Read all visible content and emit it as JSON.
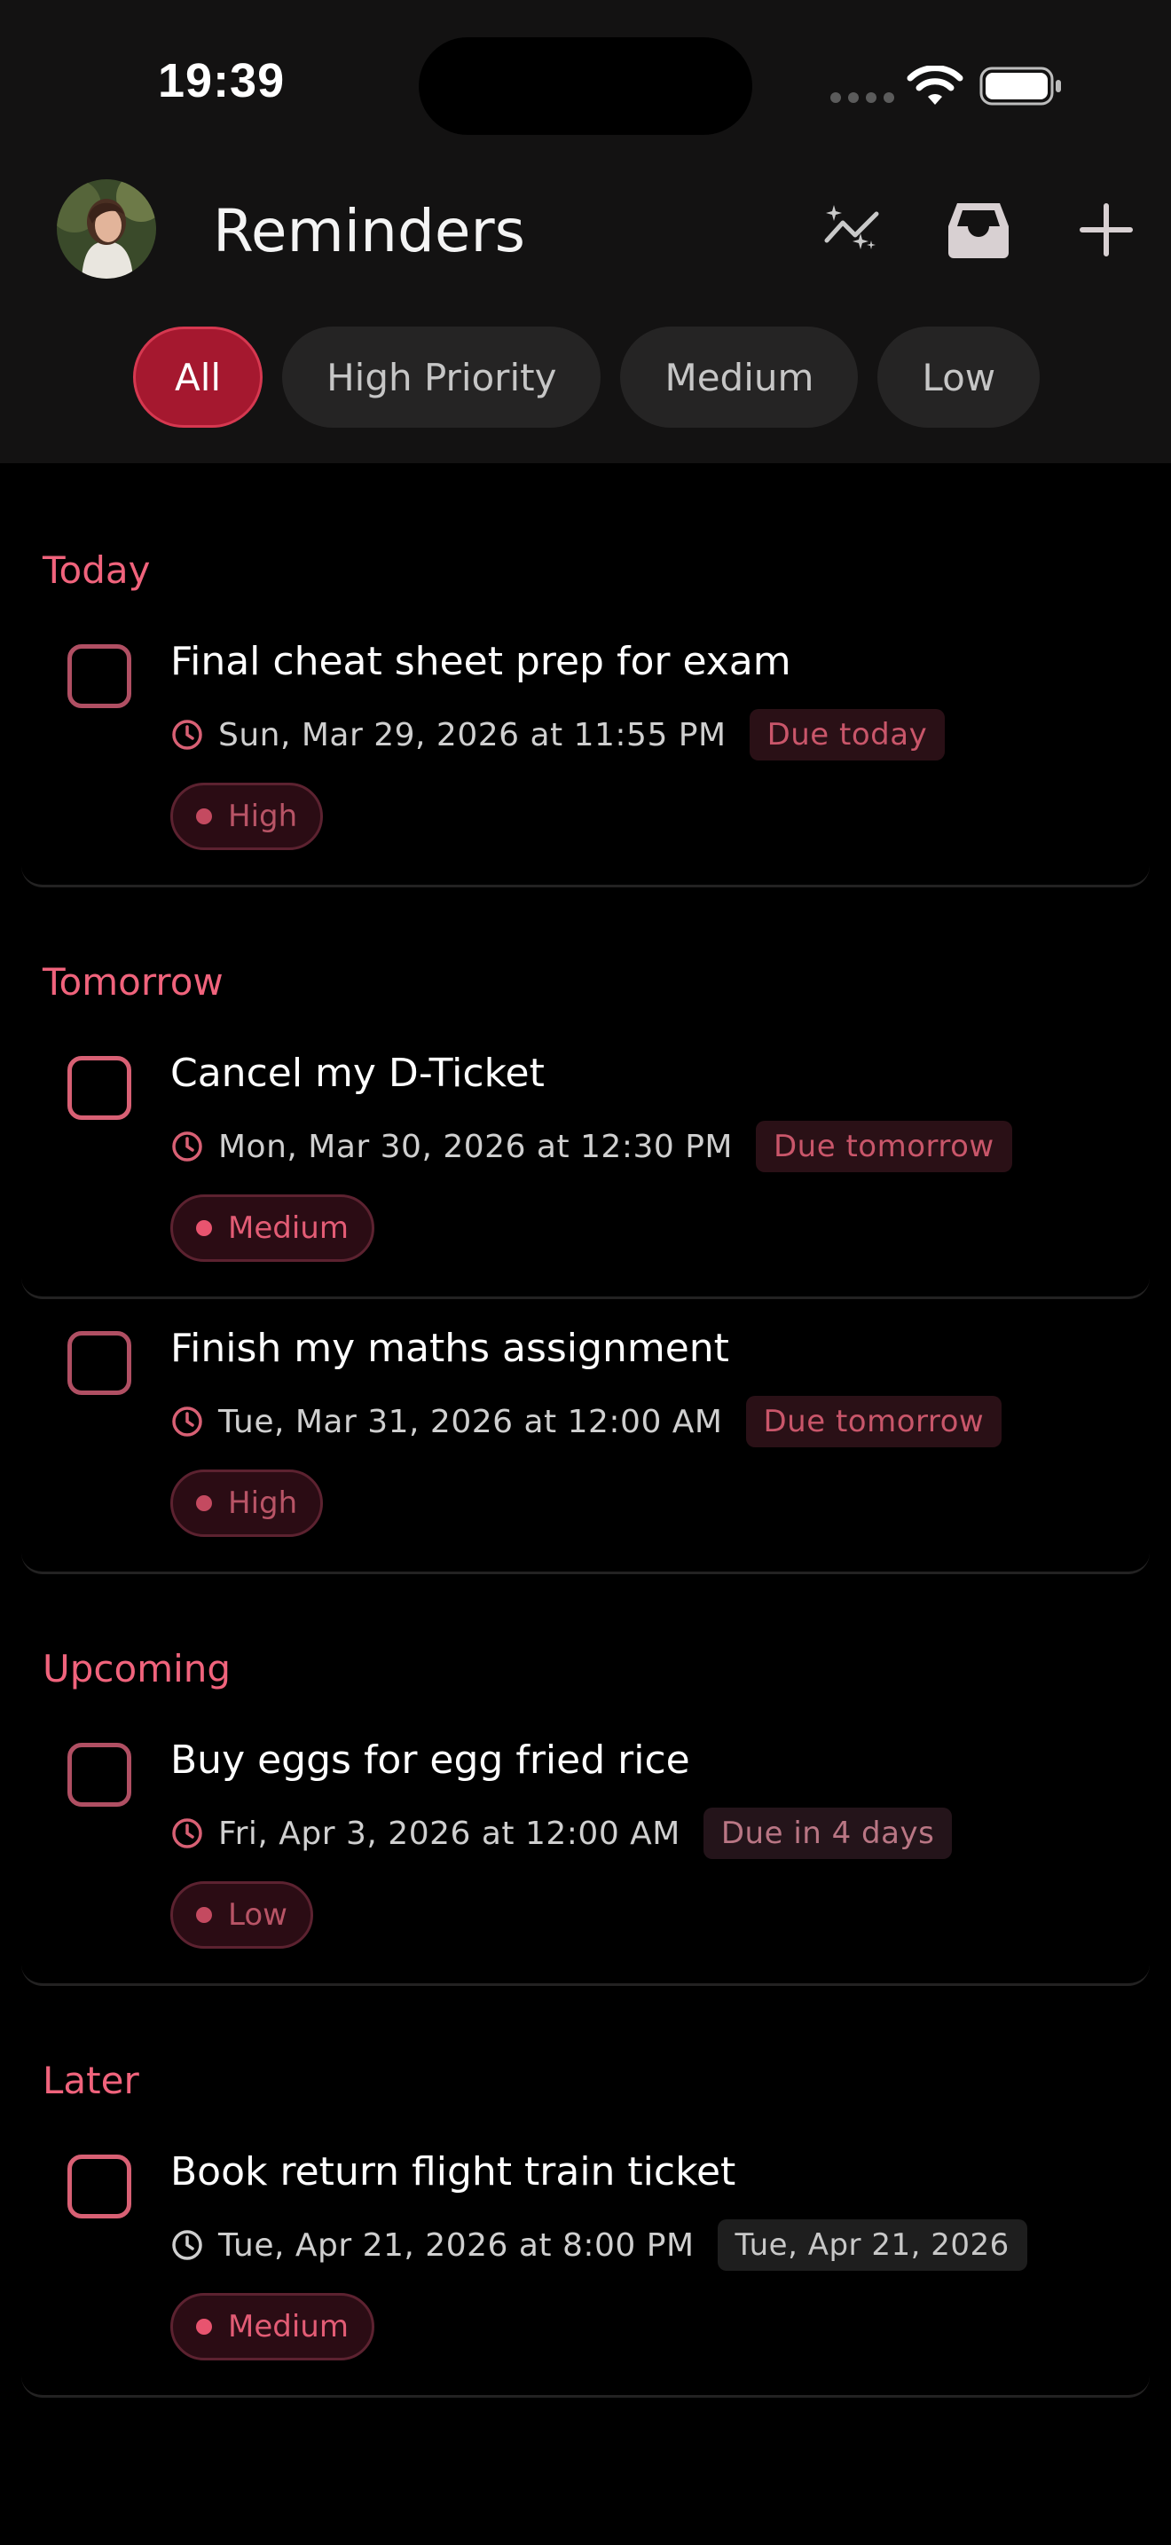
{
  "status_bar": {
    "time": "19:39"
  },
  "header": {
    "title": "Reminders",
    "actions": [
      {
        "icon": "sparkles-icon"
      },
      {
        "icon": "inbox-icon"
      },
      {
        "icon": "plus-icon"
      }
    ]
  },
  "filters": [
    {
      "label": "All",
      "active": true
    },
    {
      "label": "High Priority",
      "active": false
    },
    {
      "label": "Medium",
      "active": false
    },
    {
      "label": "Low",
      "active": false
    }
  ],
  "sections": [
    {
      "title": "Today",
      "items": [
        {
          "title": "Final cheat sheet prep for exam",
          "datetime": "Sun, Mar 29, 2026 at 11:55 PM",
          "due": "Due today",
          "priority": "High"
        }
      ]
    },
    {
      "title": "Tomorrow",
      "items": [
        {
          "title": "Cancel my D-Ticket",
          "datetime": "Mon, Mar 30, 2026 at 12:30 PM",
          "due": "Due tomorrow",
          "priority": "Medium"
        },
        {
          "title": "Finish my maths assignment",
          "datetime": "Tue, Mar 31, 2026 at 12:00 AM",
          "due": "Due tomorrow",
          "priority": "High"
        }
      ]
    },
    {
      "title": "Upcoming",
      "items": [
        {
          "title": "Buy eggs for egg fried rice",
          "datetime": "Fri, Apr 3, 2026 at 12:00 AM",
          "due": "Due in 4 days",
          "priority": "Low"
        }
      ]
    },
    {
      "title": "Later",
      "items": [
        {
          "title": "Book return flight train ticket",
          "datetime": "Tue, Apr 21, 2026 at 8:00 PM",
          "due": "Tue, Apr 21, 2026",
          "priority": "Medium"
        }
      ]
    }
  ],
  "colors": {
    "accent": "#a5182f",
    "section_header": "#f0637c",
    "checkbox": "#d86074"
  }
}
